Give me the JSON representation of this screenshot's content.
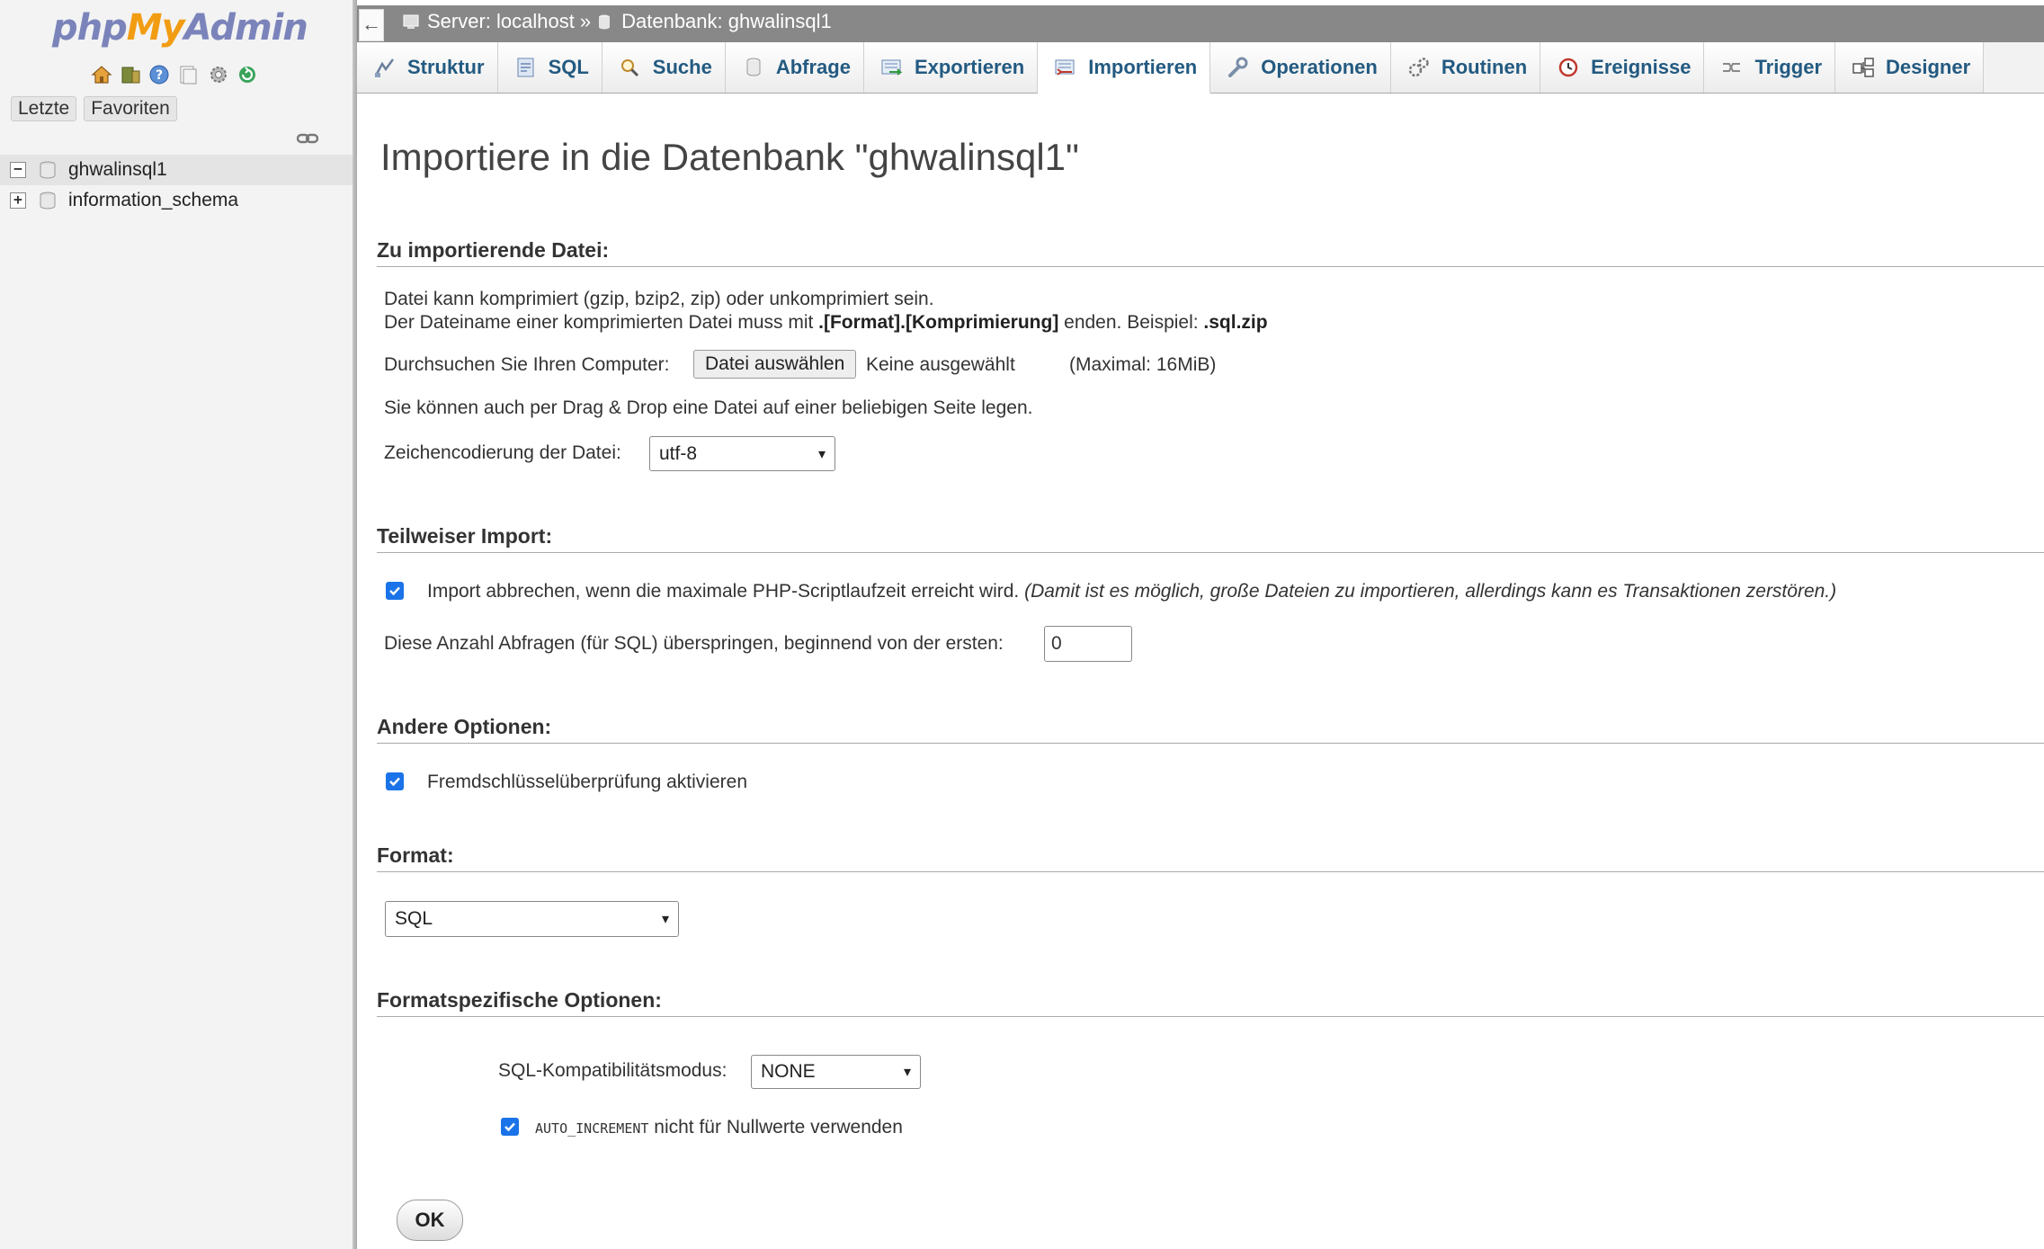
{
  "sidebar": {
    "logo": {
      "php": "php",
      "my": "My",
      "admin": "Admin"
    },
    "quick_icons": [
      "home-icon",
      "database-icon",
      "help-icon",
      "documentation-icon",
      "settings-icon",
      "reload-icon"
    ],
    "recent_label": "Letzte",
    "favorites_label": "Favoriten",
    "databases": [
      {
        "name": "ghwalinsql1",
        "expanded": true,
        "selected": true
      },
      {
        "name": "information_schema",
        "expanded": false,
        "selected": false
      }
    ]
  },
  "topbar": {
    "back_label": "←",
    "server_label": "Server: localhost",
    "separator": "»",
    "database_label": "Datenbank: ghwalinsql1"
  },
  "tabs": [
    {
      "label": "Struktur",
      "icon": "structure-icon"
    },
    {
      "label": "SQL",
      "icon": "sql-icon"
    },
    {
      "label": "Suche",
      "icon": "search-icon"
    },
    {
      "label": "Abfrage",
      "icon": "query-icon"
    },
    {
      "label": "Exportieren",
      "icon": "export-icon"
    },
    {
      "label": "Importieren",
      "icon": "import-icon",
      "active": true
    },
    {
      "label": "Operationen",
      "icon": "wrench-icon"
    },
    {
      "label": "Routinen",
      "icon": "routines-icon"
    },
    {
      "label": "Ereignisse",
      "icon": "clock-icon"
    },
    {
      "label": "Trigger",
      "icon": "trigger-icon"
    },
    {
      "label": "Designer",
      "icon": "designer-icon"
    }
  ],
  "main": {
    "title": "Importiere in die Datenbank \"ghwalinsql1\"",
    "file_section": {
      "heading": "Zu importierende Datei:",
      "line1": "Datei kann komprimiert (gzip, bzip2, zip) oder unkomprimiert sein.",
      "line2_prefix": "Der Dateiname einer komprimierten Datei muss mit ",
      "line2_bold": ".[Format].[Komprimierung]",
      "line2_mid": " enden. Beispiel: ",
      "line2_example": ".sql.zip",
      "browse_label": "Durchsuchen Sie Ihren Computer:",
      "choose_button": "Datei auswählen",
      "no_file": "Keine ausgewählt",
      "max_size": "(Maximal: 16MiB)",
      "dragdrop_hint": "Sie können auch per Drag & Drop eine Datei auf einer beliebigen Seite legen.",
      "charset_label": "Zeichencodierung der Datei:",
      "charset_value": "utf-8"
    },
    "partial_section": {
      "heading": "Teilweiser Import:",
      "interrupt_label": "Import abbrechen, wenn die maximale PHP-Scriptlaufzeit erreicht wird.",
      "interrupt_note": "(Damit ist es möglich, große Dateien zu importieren, allerdings kann es Transaktionen zerstören.)",
      "interrupt_checked": true,
      "skip_label": "Diese Anzahl Abfragen (für SQL) überspringen, beginnend von der ersten:",
      "skip_value": "0"
    },
    "other_section": {
      "heading": "Andere Optionen:",
      "fk_label": "Fremdschlüsselüberprüfung aktivieren",
      "fk_checked": true
    },
    "format_section": {
      "heading": "Format:",
      "format_value": "SQL"
    },
    "format_options_section": {
      "heading": "Formatspezifische Optionen:",
      "compat_label": "SQL-Kompatibilitätsmodus:",
      "compat_value": "NONE",
      "auto_inc_code": "AUTO_INCREMENT",
      "auto_inc_label": "nicht für Nullwerte verwenden",
      "auto_inc_checked": true
    },
    "ok_button": "OK"
  },
  "colors": {
    "accent_blue": "#235a81",
    "checkbox_blue": "#1a73e8",
    "topbar_gray": "#888888",
    "sidebar_bg": "#f3f3f3"
  }
}
